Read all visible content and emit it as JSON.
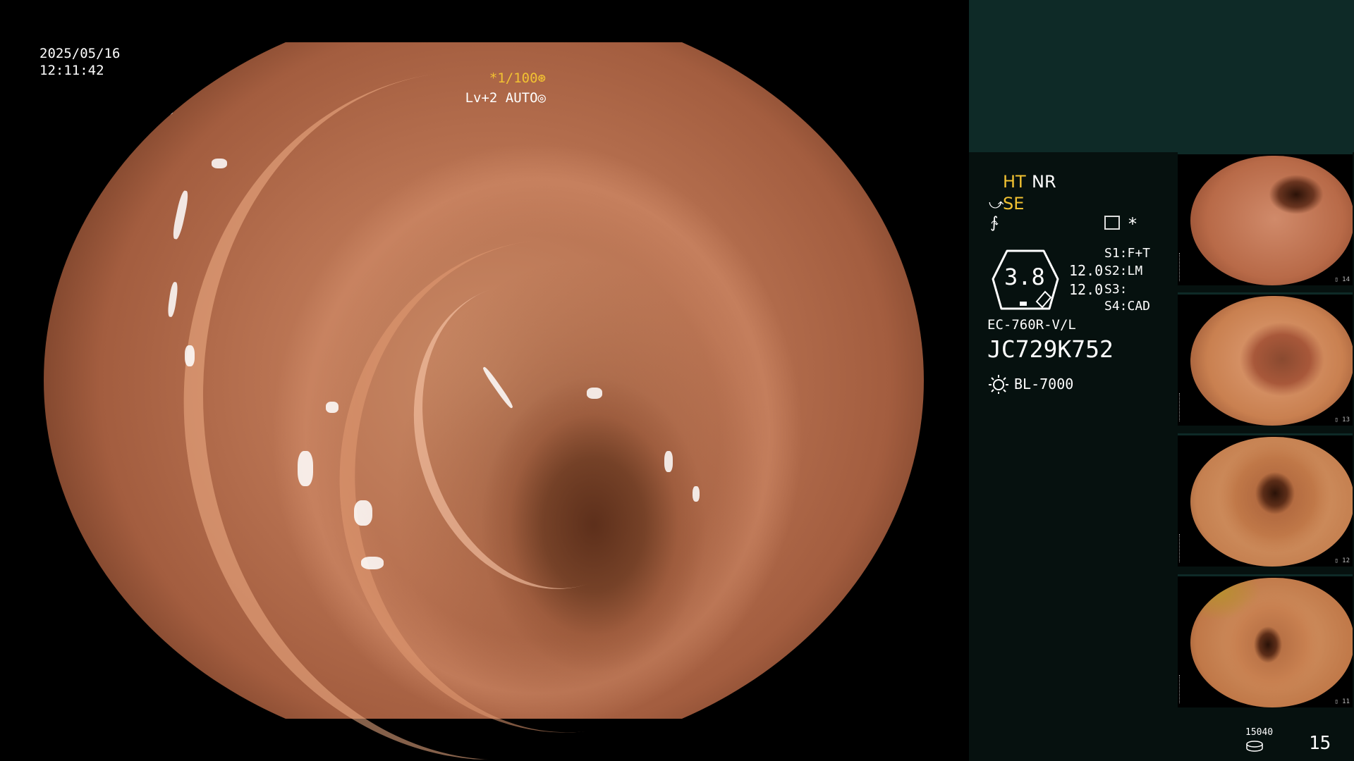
{
  "osd": {
    "date": "2025/05/16",
    "time": "12:11:42",
    "shutter": "*1/100",
    "iris": "Lv+2 AUTO"
  },
  "status_panel": {
    "ht": "HT",
    "nr": "NR",
    "se": "SE",
    "magnification": "3.8",
    "value_1": "12.0",
    "value_2": "12.0",
    "s1": "S1:F+T",
    "s2": "S2:LM",
    "s3": "S3:",
    "s4": "S4:CAD",
    "star": "*",
    "scope_model": "EC-760R-V/L",
    "scope_serial": "JC729K752",
    "light_source": "BL-7000"
  },
  "thumbnails": [
    {
      "label": "▯ 14"
    },
    {
      "label": "▯ 13"
    },
    {
      "label": "▯ 12"
    },
    {
      "label": "▯ 11"
    }
  ],
  "footer": {
    "storage_count": "15040",
    "page": "15"
  },
  "colors": {
    "accent_yellow": "#f2c232",
    "panel_bg": "#06110f",
    "panel_top": "#0e2a27"
  }
}
